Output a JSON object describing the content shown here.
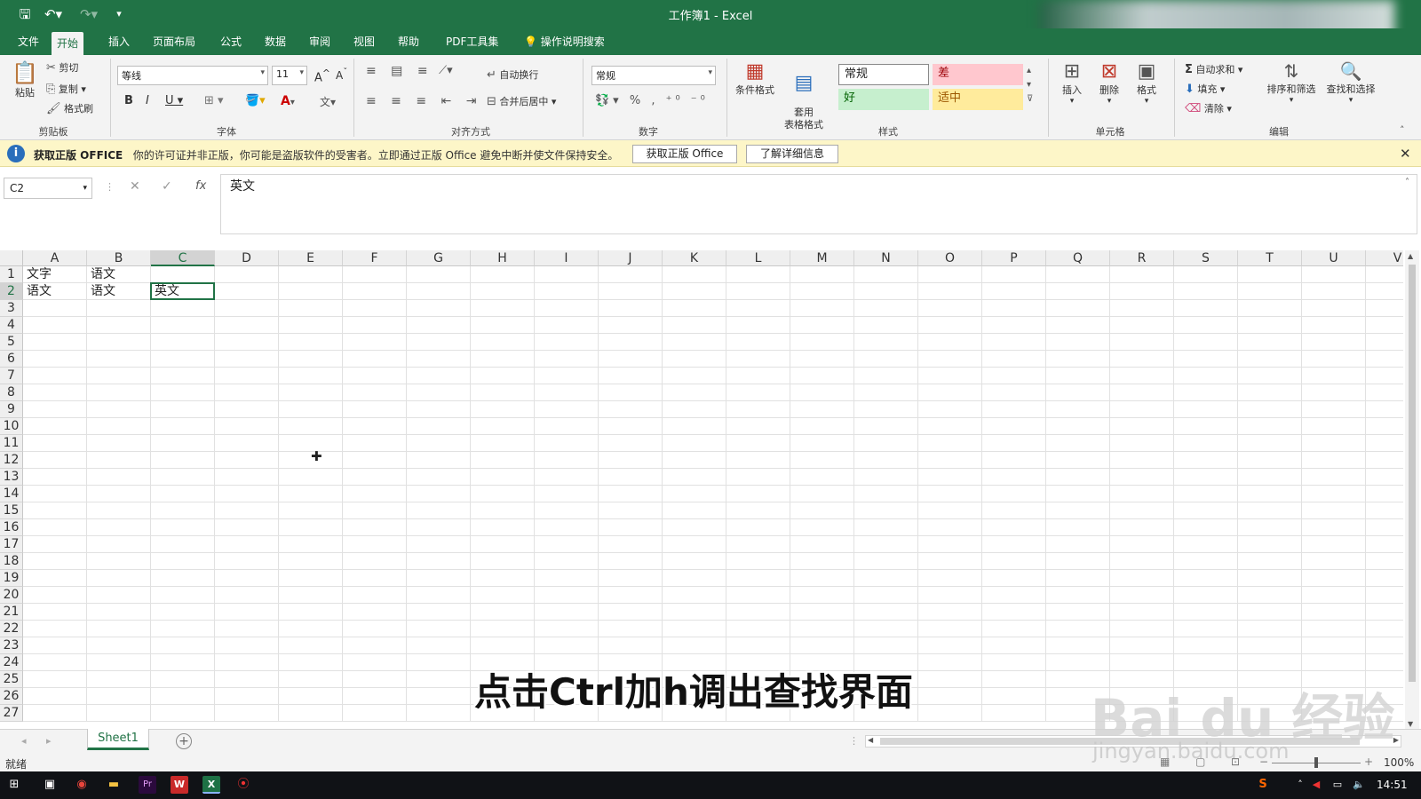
{
  "window": {
    "title": "工作簿1  -  Excel"
  },
  "tabs": [
    "文件",
    "开始",
    "插入",
    "页面布局",
    "公式",
    "数据",
    "审阅",
    "视图",
    "帮助",
    "PDF工具集"
  ],
  "tell_me": "操作说明搜索",
  "ribbon": {
    "clipboard": {
      "paste": "粘贴",
      "cut": "剪切",
      "copy": "复制",
      "format_painter": "格式刷",
      "label": "剪贴板"
    },
    "font": {
      "name": "等线",
      "size": "11",
      "label": "字体"
    },
    "alignment": {
      "wrap": "自动换行",
      "merge": "合并后居中",
      "label": "对齐方式"
    },
    "number": {
      "format": "常规",
      "label": "数字"
    },
    "styles": {
      "cond": "条件格式",
      "table": "套用\n表格格式",
      "normal": "常规",
      "bad": "差",
      "good": "好",
      "neutral": "适中",
      "label": "样式"
    },
    "cells": {
      "insert": "插入",
      "delete": "删除",
      "format": "格式",
      "label": "单元格"
    },
    "editing": {
      "autosum": "自动求和",
      "fill": "填充",
      "clear": "清除",
      "sort": "排序和筛选",
      "find": "查找和选择",
      "label": "编辑"
    }
  },
  "infobar": {
    "title": "获取正版 OFFICE",
    "message": "你的许可证并非正版，你可能是盗版软件的受害者。立即通过正版 Office 避免中断并使文件保持安全。",
    "btn_get": "获取正版 Office",
    "btn_learn": "了解详细信息"
  },
  "formula_bar": {
    "name_box": "C2",
    "value": "英文"
  },
  "grid": {
    "columns": [
      "A",
      "B",
      "C",
      "D",
      "E",
      "F",
      "G",
      "H",
      "I",
      "J",
      "K",
      "L",
      "M",
      "N",
      "O",
      "P",
      "Q",
      "R",
      "S",
      "T",
      "U",
      "V"
    ],
    "rows": [
      "1",
      "2",
      "3",
      "4",
      "5",
      "6",
      "7",
      "8",
      "9",
      "10",
      "11",
      "12",
      "13",
      "14",
      "15",
      "16",
      "17",
      "18",
      "19",
      "20",
      "21",
      "22",
      "23",
      "24",
      "25",
      "26",
      "27"
    ],
    "cells": {
      "A1": "文字",
      "B1": "语文",
      "A2": "语文",
      "B2": "语文",
      "C2": "英文"
    },
    "selected": "C2"
  },
  "sheet": {
    "name": "Sheet1"
  },
  "status": {
    "ready": "就绪",
    "zoom": "100%"
  },
  "clock": "14:51",
  "subtitle": "点击Ctrl加h调出查找界面",
  "watermark": {
    "brand": "Bai du 经验",
    "url": "jingyan.baidu.com"
  }
}
